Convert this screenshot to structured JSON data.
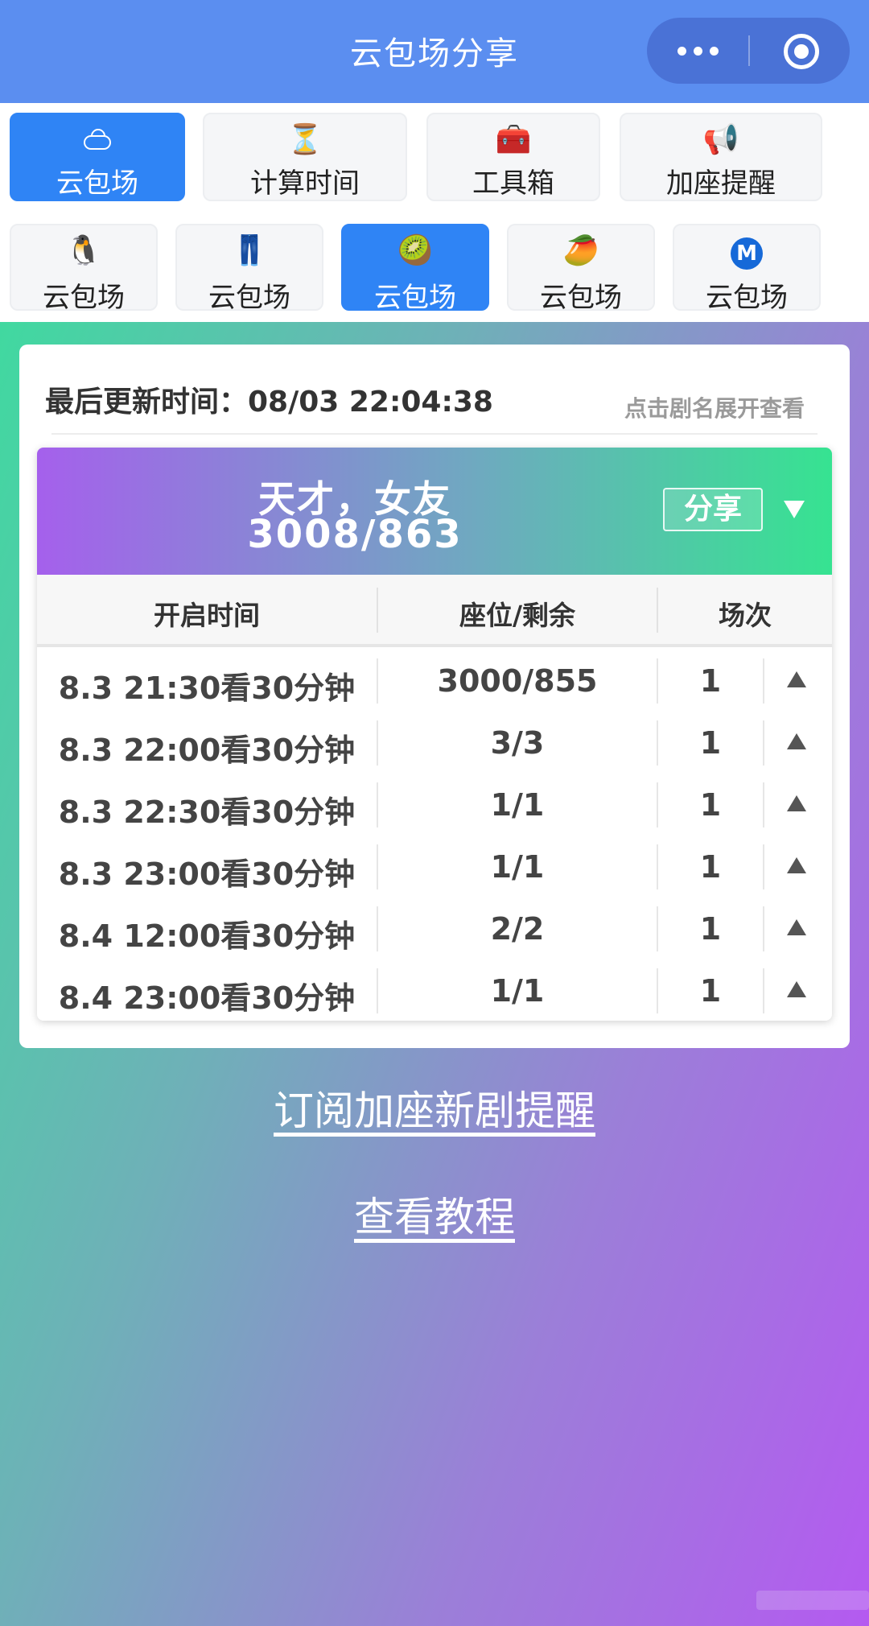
{
  "app": {
    "title": "云包场分享"
  },
  "main_tabs": [
    {
      "label": "云包场",
      "icon": "cloud-icon",
      "active": true
    },
    {
      "label": "计算时间",
      "icon": "hourglass-icon",
      "emoji": "⏳",
      "active": false
    },
    {
      "label": "工具箱",
      "icon": "toolbox-icon",
      "emoji": "🧰",
      "active": false
    },
    {
      "label": "加座提醒",
      "icon": "megaphone-icon",
      "emoji": "📢",
      "active": false
    }
  ],
  "platform_tabs": [
    {
      "label": "云包场",
      "icon": "penguin-icon",
      "emoji": "🐧",
      "active": false
    },
    {
      "label": "云包场",
      "icon": "jeans-icon",
      "emoji": "👖",
      "active": false
    },
    {
      "label": "云包场",
      "icon": "kiwi-icon",
      "emoji": "🥝",
      "active": true
    },
    {
      "label": "云包场",
      "icon": "mango-icon",
      "emoji": "🥭",
      "active": false
    },
    {
      "label": "云包场",
      "icon": "metro-icon",
      "emoji": "M",
      "active": false
    }
  ],
  "update": {
    "label": "最后更新时间：08/03 22:04:38",
    "hint": "点击剧名展开查看"
  },
  "show": {
    "name": "天才，女友",
    "count": "3008/863",
    "share_label": "分享",
    "header_gradient": [
      "#a560ec",
      "#36e391"
    ]
  },
  "table": {
    "columns": [
      "开启时间",
      "座位/剩余",
      "场次"
    ],
    "rows": [
      {
        "time": "8.3 21:30看30分钟",
        "seats": "3000/855",
        "sessions": "1"
      },
      {
        "time": "8.3 22:00看30分钟",
        "seats": "3/3",
        "sessions": "1"
      },
      {
        "time": "8.3 22:30看30分钟",
        "seats": "1/1",
        "sessions": "1"
      },
      {
        "time": "8.3 23:00看30分钟",
        "seats": "1/1",
        "sessions": "1"
      },
      {
        "time": "8.4 12:00看30分钟",
        "seats": "2/2",
        "sessions": "1"
      },
      {
        "time": "8.4 23:00看30分钟",
        "seats": "1/1",
        "sessions": "1"
      }
    ]
  },
  "links": {
    "subscribe": "订阅加座新剧提醒",
    "tutorial": "查看教程"
  },
  "colors": {
    "nav_bg": "#5b8ef0",
    "active_tab": "#2f84f5",
    "background_gradient": [
      "#35e39a",
      "#b45af0"
    ]
  }
}
